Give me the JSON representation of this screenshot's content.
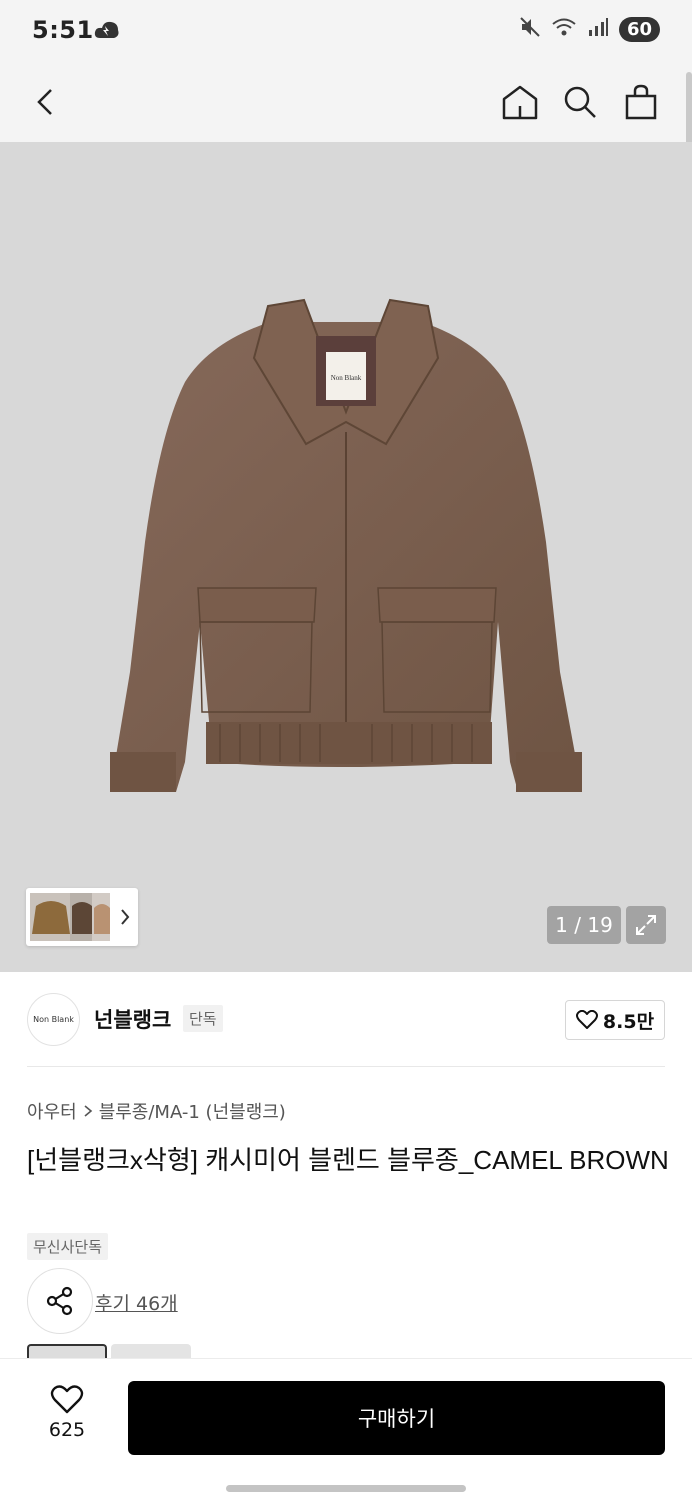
{
  "status": {
    "time": "5:51",
    "battery": "60"
  },
  "header": {
    "back_icon": "chevron-left-icon",
    "home_icon": "home-icon",
    "search_icon": "search-icon",
    "cart_icon": "shopping-bag-icon"
  },
  "gallery": {
    "label_on_product": "Non Blank",
    "counter": "1 / 19",
    "current": 1,
    "total": 19
  },
  "brand": {
    "logo_text": "Non Blank",
    "name": "넌블랭크",
    "tag": "단독",
    "likes": "8.5만"
  },
  "breadcrumb": {
    "category": "아우터",
    "subcategory": "블루종/MA-1 (넌블랭크)"
  },
  "product": {
    "title": "[넌블랭크x삭형] 캐시미어 블렌드 블루종_CAMEL BROWN",
    "exclusive_tag": "무신사단독",
    "review_link": "후기 46개"
  },
  "bottom": {
    "wish_count": "625",
    "buy_label": "구매하기"
  },
  "colors": {
    "primary": "#000000",
    "hero_bg": "#d8d8d8",
    "jacket": "#7b5f4b"
  }
}
